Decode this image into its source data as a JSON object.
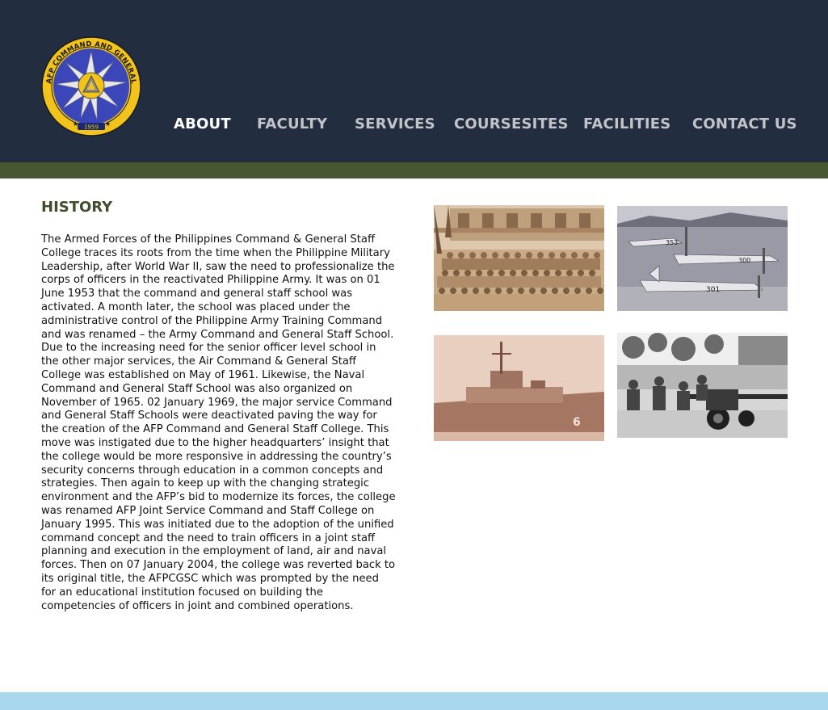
{
  "logo": {
    "ring_text_top": "AFP COMMAND AND GENERAL STAFF COLLEGE",
    "year": "1959"
  },
  "nav": {
    "items": [
      {
        "label": "ABOUT",
        "active": true
      },
      {
        "label": "FACULTY",
        "active": false
      },
      {
        "label": "SERVICES",
        "active": false
      },
      {
        "label": "COURSESITES",
        "active": false
      },
      {
        "label": "FACILITIES",
        "active": false
      },
      {
        "label": "CONTACT US",
        "active": false
      }
    ]
  },
  "history": {
    "title": "HISTORY",
    "body": "The Armed Forces of the Philippines Command & General Staff College traces its roots from the time when the Philippine Military Leadership, after World War II, saw the need to professionalize the corps of officers in the reactivated Philippine Army. It was on 01 June 1953 that the command and general staff school was activated.  A month later, the school was placed under the administrative control of the Philippine Army Training Command and was renamed – the Army Command and General Staff School. Due to the increasing need for the senior officer level school in the other major services, the Air Command & General Staff College was established on May of 1961. Likewise, the Naval Command and General Staff School was also organized on November of 1965. 02 January 1969, the major service Command and General Staff Schools were deactivated paving the way for the creation of the AFP Command and General Staff College.  This move was instigated due to the higher headquarters’ insight that the college would be more responsive in addressing the country’s security concerns through education in a common concepts and strategies. Then again to keep up with the changing strategic environment and the AFP’s bid to modernize its forces, the college was renamed AFP Joint Service Command and Staff College on January 1995. This was initiated due to the adoption of the unified command concept and the need to train officers in a joint staff planning and execution in the employment of land, air and naval forces. Then on 07 January 2004, the college was reverted back to its original title, the AFPCGSC which was prompted by the need for an educational institution focused on building the competencies of officers in joint and combined operations."
  },
  "photos": {
    "aircraft_tail_numbers": [
      "353",
      "300",
      "301"
    ],
    "ship_hull_number": "6"
  },
  "colors": {
    "header_bg": "#222d40",
    "accent_green": "#475730",
    "title_green": "#3f4e2d",
    "footer_blue": "#a8d7ee",
    "nav_active": "#ffffff",
    "nav_inactive": "#c2c4c8"
  }
}
